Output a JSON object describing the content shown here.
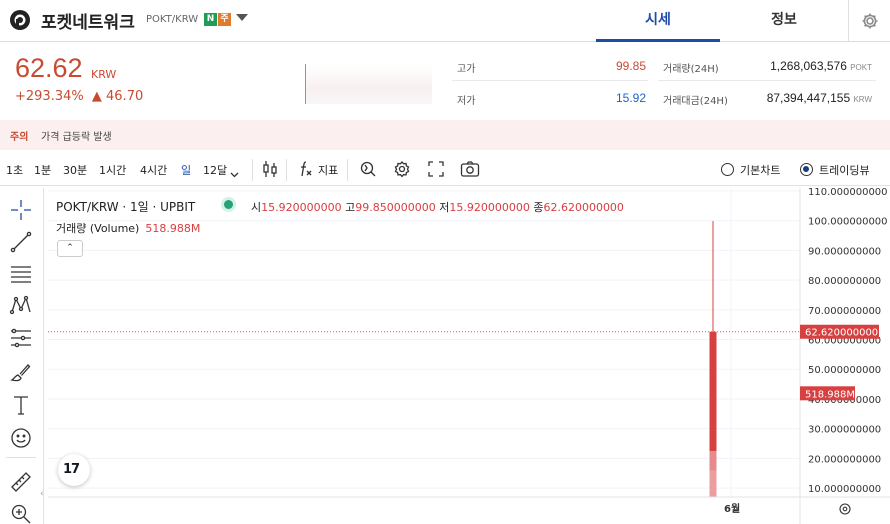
{
  "header": {
    "coin_name": "포켓네트워크",
    "pair": "POKT/KRW",
    "badge_n": "N",
    "badge_j": "주",
    "tabs": [
      {
        "label": "시세",
        "active": true
      },
      {
        "label": "정보",
        "active": false
      }
    ]
  },
  "price": {
    "current": "62.62",
    "unit": "KRW",
    "change_rate": "+293.34%",
    "change_arrow": "▲",
    "change_amount": "46.70",
    "color_up": "#c84a31"
  },
  "stats": {
    "high_label": "고가",
    "high_value": "99.85",
    "low_label": "저가",
    "low_value": "15.92",
    "volume_label": "거래량(24H)",
    "volume_value": "1,268,063,576",
    "volume_unit": "POKT",
    "turnover_label": "거래대금(24H)",
    "turnover_value": "87,394,447,155",
    "turnover_unit": "KRW"
  },
  "warning": {
    "tag": "주의",
    "text": "가격 급등락 발생"
  },
  "toolbar": {
    "timeframes": [
      {
        "label": "1초",
        "active": false
      },
      {
        "label": "1분",
        "active": false
      },
      {
        "label": "30분",
        "active": false
      },
      {
        "label": "1시간",
        "active": false
      },
      {
        "label": "4시간",
        "active": false
      },
      {
        "label": "일",
        "active": true
      },
      {
        "label": "12달",
        "active": false
      }
    ],
    "indicator_label": "지표",
    "view_basic": "기본차트",
    "view_trading": "트레이딩뷰",
    "selected_view": "trading"
  },
  "chart_legend": {
    "symbol": "POKT/KRW · 1일 · UPBIT",
    "open_label": "시",
    "open": "15.920000000",
    "high_label": "고",
    "high": "99.850000000",
    "low_label": "저",
    "low": "15.920000000",
    "close_label": "종",
    "close": "62.620000000",
    "volume_label": "거래량 (Volume)",
    "volume": "518.988M",
    "collapse_glyph": "⌃"
  },
  "chart_data": {
    "type": "candlestick",
    "x_tick_labels": [
      "6월"
    ],
    "y_tick_labels": [
      "10.000000000",
      "20.000000000",
      "30.000000000",
      "40.000000000",
      "50.000000000",
      "60.000000000",
      "70.000000000",
      "80.000000000",
      "90.000000000",
      "100.000000000",
      "110.000000000"
    ],
    "ylim": [
      7,
      111
    ],
    "candles": [
      {
        "open": 15.92,
        "high": 99.85,
        "low": 15.92,
        "close": 62.62
      }
    ],
    "current_price_label": "62.620000000",
    "current_price": 62.62,
    "volume_label": "518.988M",
    "volume_label_value": 41.9,
    "volume_bar_value": 22.5,
    "colors": {
      "up": "#d74040",
      "volume": "#e89494",
      "price_line": "#e05656"
    }
  }
}
